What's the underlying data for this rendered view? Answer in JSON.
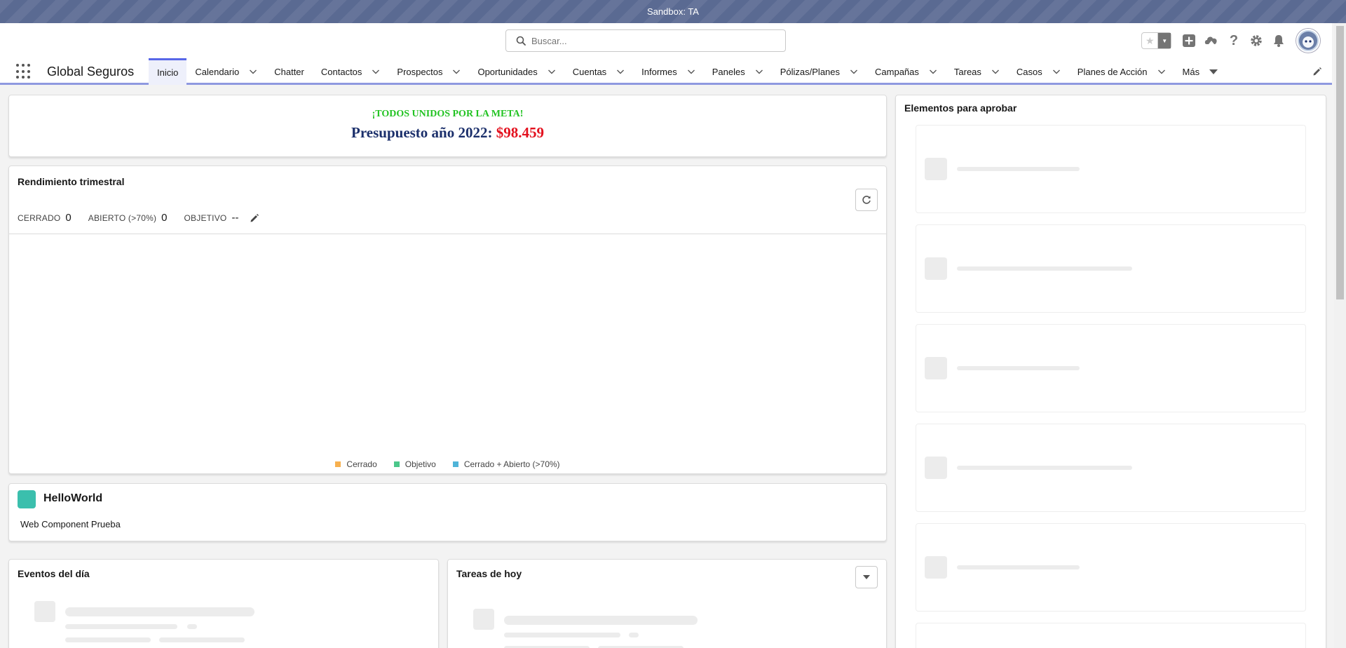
{
  "sandbox_banner": "Sandbox: TA",
  "search": {
    "placeholder": "Buscar..."
  },
  "header_icons": [
    "favorites-star-icon",
    "favorites-dropdown-icon",
    "global-actions-plus-icon",
    "trailhead-icon",
    "help-icon",
    "setup-gear-icon",
    "notifications-bell-icon",
    "avatar"
  ],
  "app": {
    "name": "Global Seguros"
  },
  "nav": {
    "items": [
      {
        "label": "Inicio",
        "active": true,
        "chevron": false
      },
      {
        "label": "Calendario",
        "chevron": true
      },
      {
        "label": "Chatter",
        "chevron": false
      },
      {
        "label": "Contactos",
        "chevron": true
      },
      {
        "label": "Prospectos",
        "chevron": true
      },
      {
        "label": "Oportunidades",
        "chevron": true
      },
      {
        "label": "Cuentas",
        "chevron": true
      },
      {
        "label": "Informes",
        "chevron": true
      },
      {
        "label": "Paneles",
        "chevron": true
      },
      {
        "label": "Pólizas/Planes",
        "chevron": true
      },
      {
        "label": "Campañas",
        "chevron": true
      },
      {
        "label": "Tareas",
        "chevron": true
      },
      {
        "label": "Casos",
        "chevron": true
      },
      {
        "label": "Planes de Acción",
        "chevron": true
      },
      {
        "label": "Más",
        "more": true
      }
    ]
  },
  "banner": {
    "headline": "¡TODOS UNIDOS POR LA META!",
    "budget_label": "Presupuesto año 2022: ",
    "budget_value": "$98.459",
    "headline_color": "#22c322",
    "budget_label_color": "#1b2f6b",
    "budget_value_color": "#e3111e"
  },
  "performance": {
    "title": "Rendimiento trimestral",
    "metrics": [
      {
        "label": "CERRADO",
        "value": "0"
      },
      {
        "label": "ABIERTO (>70%)",
        "value": "0"
      },
      {
        "label": "OBJETIVO",
        "value": "--"
      }
    ],
    "legend": [
      {
        "label": "Cerrado",
        "color": "#f7b04f"
      },
      {
        "label": "Objetivo",
        "color": "#4bc78a"
      },
      {
        "label": "Cerrado + Abierto (>70%)",
        "color": "#4fb4d8"
      }
    ]
  },
  "hello": {
    "title": "HelloWorld",
    "body": "Web Component Prueba",
    "icon_color": "#3bbfad"
  },
  "events": {
    "title": "Eventos del día"
  },
  "tasks": {
    "title": "Tareas de hoy"
  },
  "approvals": {
    "title": "Elementos para aprobar"
  },
  "colors": {
    "nav_accent": "#5867e8",
    "sandbox_bar": "#5a6a92"
  }
}
